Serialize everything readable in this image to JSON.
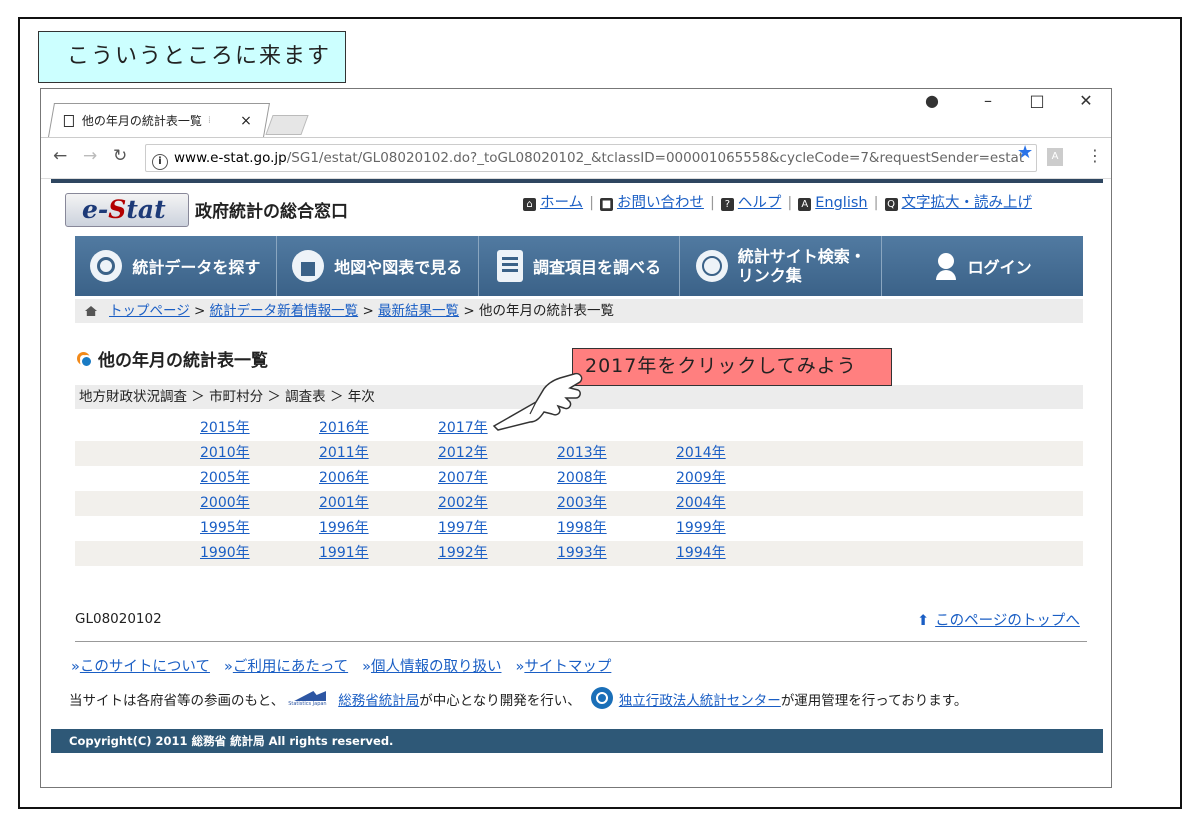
{
  "caption": "こういうところに来ます",
  "callout": "2017年をクリックしてみよう",
  "browser": {
    "tab_title": "他の年月の統計表一覧",
    "tab_close": "×",
    "url_host": "www.e-stat.go.jp",
    "url_rest": "/SG1/estat/GL08020102.do?_toGL08020102_&tclassID=000001065558&cycleCode=7&requestSender=estat"
  },
  "site": {
    "logo": "e-Stat",
    "name": "政府統計の総合窓口",
    "util_nav": [
      "ホーム",
      "お問い合わせ",
      "ヘルプ",
      "English",
      "文字拡大・読み上げ"
    ],
    "main_nav": [
      "統計データを探す",
      "地図や図表で見る",
      "調査項目を調べる",
      "統計サイト検索・",
      "リンク集",
      "ログイン"
    ]
  },
  "breadcrumb": {
    "items": [
      "トップページ",
      "統計データ新着情報一覧",
      "最新結果一覧"
    ],
    "current": "他の年月の統計表一覧",
    "sep": ">"
  },
  "section_title": "他の年月の統計表一覧",
  "survey_path": "地方財政状況調査 ＞ 市町村分 ＞ 調査表 ＞ 年次",
  "years": [
    [
      "2015年",
      "2016年",
      "2017年"
    ],
    [
      "2010年",
      "2011年",
      "2012年",
      "2013年",
      "2014年"
    ],
    [
      "2005年",
      "2006年",
      "2007年",
      "2008年",
      "2009年"
    ],
    [
      "2000年",
      "2001年",
      "2002年",
      "2003年",
      "2004年"
    ],
    [
      "1995年",
      "1996年",
      "1997年",
      "1998年",
      "1999年"
    ],
    [
      "1990年",
      "1991年",
      "1992年",
      "1993年",
      "1994年"
    ]
  ],
  "page_id": "GL08020102",
  "to_top": "このページのトップへ",
  "footer_links": [
    "このサイトについて",
    "ご利用にあたって",
    "個人情報の取り扱い",
    "サイトマップ"
  ],
  "footer_note": {
    "a": "当サイトは各府省等の参画のもと、",
    "sj_text": "Statistics Japan",
    "link1": "総務省統計局",
    "b": "が中心となり開発を行い、",
    "link2": "独立行政法人統計センター",
    "c": "が運用管理を行っております。"
  },
  "copyright": "Copyright(C) 2011 総務省 統計局 All rights reserved.",
  "colors": {
    "nav": "#3b6288",
    "link": "#1a5ec4",
    "callout": "#ff7f7f",
    "caption": "#ccffff"
  }
}
